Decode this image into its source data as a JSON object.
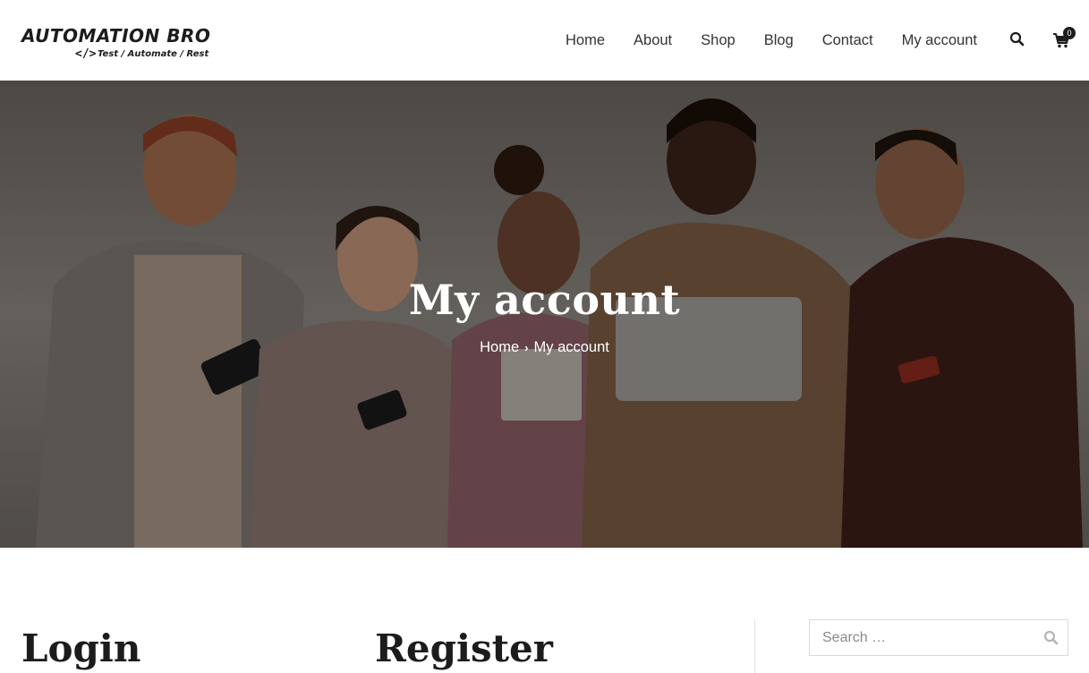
{
  "header": {
    "logo_title": "AUTOMATION BRO",
    "logo_code": "</>",
    "logo_tagline": "Test / Automate / Rest",
    "nav": [
      "Home",
      "About",
      "Shop",
      "Blog",
      "Contact",
      "My account"
    ],
    "search_icon": "search-icon",
    "cart_icon": "cart-icon",
    "cart_count": "0"
  },
  "hero": {
    "title": "My account",
    "breadcrumb": {
      "home": "Home",
      "current": "My account"
    }
  },
  "main": {
    "login_heading": "Login",
    "register_heading": "Register"
  },
  "sidebar": {
    "search_placeholder": "Search …"
  },
  "colors": {
    "text_dark": "#1c1c1c",
    "hero_text": "#ffffff",
    "border": "#d9d9d9"
  }
}
